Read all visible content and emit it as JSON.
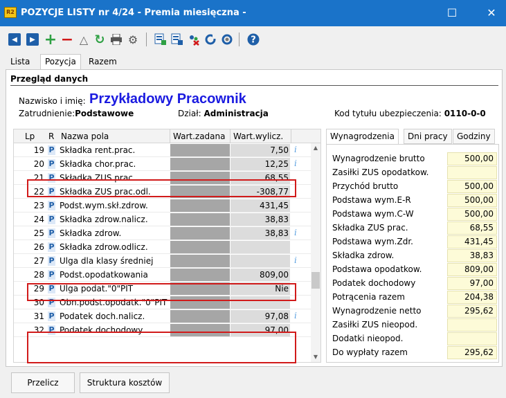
{
  "window": {
    "app_icon": "R2",
    "title": "POZYCJE LISTY nr 4/24 - Premia miesięczna -",
    "maximize_glyph": "☐",
    "close_glyph": "✕"
  },
  "toolbar": {
    "icons": [
      "prev-icon",
      "next-icon",
      "add-icon",
      "remove-icon",
      "warning-icon",
      "refresh-icon",
      "print-icon",
      "settings-icon",
      "calc-icon",
      "calc-list-icon",
      "delete-calc-icon",
      "cycle-icon",
      "user-refresh-icon",
      "help-icon"
    ]
  },
  "tabs": [
    "Lista",
    "Pozycja",
    "Razem"
  ],
  "section": {
    "title": "Przegląd danych",
    "name_label": "Nazwisko i imię:",
    "name_value": "Przykładowy Pracownik",
    "employment_label": "Zatrudnienie:",
    "employment_value": "Podstawowe",
    "department_label": "Dział:",
    "department_value": "Administracja",
    "insurance_label": "Kod tytułu ubezpieczenia:",
    "insurance_value": "0110-0-0"
  },
  "grid": {
    "columns": [
      "Lp",
      "R",
      "Nazwa pola",
      "Wart.zadana",
      "Wart.wylicz."
    ],
    "info_glyph": "i",
    "rows": [
      {
        "lp": "19",
        "r": "P",
        "name": "Składka rent.prac.",
        "value": "7,50",
        "info": true
      },
      {
        "lp": "20",
        "r": "P",
        "name": "Składka chor.prac.",
        "value": "12,25",
        "info": true
      },
      {
        "lp": "21",
        "r": "P",
        "name": "Składka ZUS prac.",
        "value": "68,55",
        "info": false
      },
      {
        "lp": "22",
        "r": "P",
        "name": "Składka ZUS prac.odl.",
        "value": "-308,77",
        "info": false
      },
      {
        "lp": "23",
        "r": "P",
        "name": "Podst.wym.skł.zdrow.",
        "value": "431,45",
        "info": false
      },
      {
        "lp": "24",
        "r": "P",
        "name": "Składka zdrow.nalicz.",
        "value": "38,83",
        "info": false
      },
      {
        "lp": "25",
        "r": "P",
        "name": "Składka zdrow.",
        "value": "38,83",
        "info": true
      },
      {
        "lp": "26",
        "r": "P",
        "name": "Składka zdrow.odlicz.",
        "value": "",
        "info": false
      },
      {
        "lp": "27",
        "r": "P",
        "name": "Ulga dla klasy średniej",
        "value": "",
        "info": true
      },
      {
        "lp": "28",
        "r": "P",
        "name": "Podst.opodatkowania",
        "value": "809,00",
        "info": false
      },
      {
        "lp": "29",
        "r": "P",
        "name": "Ulga podat.\"0\"PIT",
        "value": "Nie",
        "info": false
      },
      {
        "lp": "30",
        "r": "P",
        "name": "Obn.podst.opodatk.\"0\"PIT",
        "value": "",
        "info": false
      },
      {
        "lp": "31",
        "r": "P",
        "name": "Podatek doch.nalicz.",
        "value": "97,08",
        "info": true
      },
      {
        "lp": "32",
        "r": "P",
        "name": "Podatek dochodowy",
        "value": "97,00",
        "info": false
      }
    ]
  },
  "right_tabs": [
    "Wynagrodzenia",
    "Dni pracy",
    "Godziny"
  ],
  "summary": [
    {
      "label": "Wynagrodzenie brutto",
      "value": "500,00"
    },
    {
      "label": "Zasiłki ZUS opodatkow.",
      "value": ""
    },
    {
      "label": "Przychód brutto",
      "value": "500,00"
    },
    {
      "label": "Podstawa wym.E-R",
      "value": "500,00"
    },
    {
      "label": "Podstawa wym.C-W",
      "value": "500,00"
    },
    {
      "label": "Składka ZUS prac.",
      "value": "68,55"
    },
    {
      "label": "Podstawa wym.Zdr.",
      "value": "431,45"
    },
    {
      "label": "Składka zdrow.",
      "value": "38,83"
    },
    {
      "label": "Podstawa opodatkow.",
      "value": "809,00"
    },
    {
      "label": "Podatek dochodowy",
      "value": "97,00"
    },
    {
      "label": "Potrącenia razem",
      "value": "204,38"
    },
    {
      "label": "Wynagrodzenie netto",
      "value": "295,62"
    },
    {
      "label": "Zasiłki ZUS nieopod.",
      "value": ""
    },
    {
      "label": "Dodatki nieopod.",
      "value": ""
    },
    {
      "label": "Do wypłaty razem",
      "value": "295,62"
    }
  ],
  "buttons": {
    "recalc": "Przelicz",
    "cost_structure": "Struktura kosztów"
  },
  "colors": {
    "titlebar": "#1a73c9",
    "highlight": "#d11a1a",
    "employee_name": "#1a1ae0",
    "summary_field": "#fdfbd8"
  }
}
